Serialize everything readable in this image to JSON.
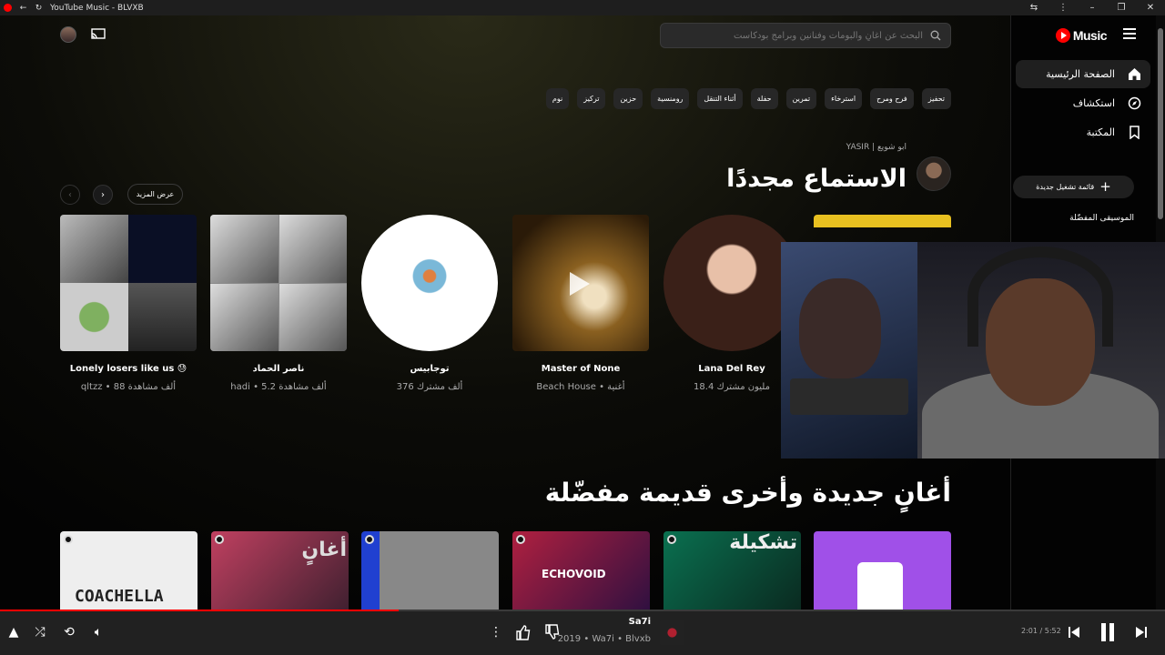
{
  "window": {
    "title": "YouTube Music - BLVXB"
  },
  "header": {
    "search_placeholder": "البحث عن أغانٍ وألبومات وفنانين وبرامج بودكاست"
  },
  "sidebar": {
    "logo": "Music",
    "items": [
      {
        "label": "الصفحة الرئيسية",
        "icon": "home-icon",
        "active": true
      },
      {
        "label": "استكشاف",
        "icon": "compass-icon",
        "active": false
      },
      {
        "label": "المكتبة",
        "icon": "bookmark-icon",
        "active": false
      }
    ],
    "new_playlist": "قائمة تشغيل جديدة",
    "fav_label": "الموسيقى المفضّلة"
  },
  "chips": [
    "تحفيز",
    "فرح ومرح",
    "استرخاء",
    "تمرين",
    "حفلة",
    "أثناء التنقل",
    "رومنسية",
    "حزين",
    "تركيز",
    "نوم"
  ],
  "section1": {
    "subtitle": "YASIR | ابو شويع",
    "title": "الاستماع مجددًا",
    "more": "عرض المزيد",
    "cards": [
      {
        "title": "Lonely losers like us 😓",
        "sub": "qltzz • 88 ألف مشاهدة"
      },
      {
        "title": "ناصر الحماد",
        "sub": "hadi • 5.2 ألف مشاهدة"
      },
      {
        "title": "توجابيس",
        "sub": "376 ألف مشترك"
      },
      {
        "title": "Master of None",
        "sub": "Beach House • أغنية"
      },
      {
        "title": "Lana Del Rey",
        "sub": "18.4 مليون مشترك"
      }
    ]
  },
  "section2": {
    "title": "أغانٍ جديدة وأخرى قديمة مفضّلة",
    "tiles": [
      "COACHELLA",
      "أغانٍ",
      "",
      "ECHOVOID",
      "تشكيلة",
      ""
    ]
  },
  "player": {
    "title": "Sa7i",
    "sub": "2019 • Wa7i • Blvxb",
    "time": "2:01 / 5:52",
    "progress": 0.342
  },
  "colors": {
    "accent": "#ff0000",
    "bg": "#030303",
    "chip": "#272727"
  }
}
